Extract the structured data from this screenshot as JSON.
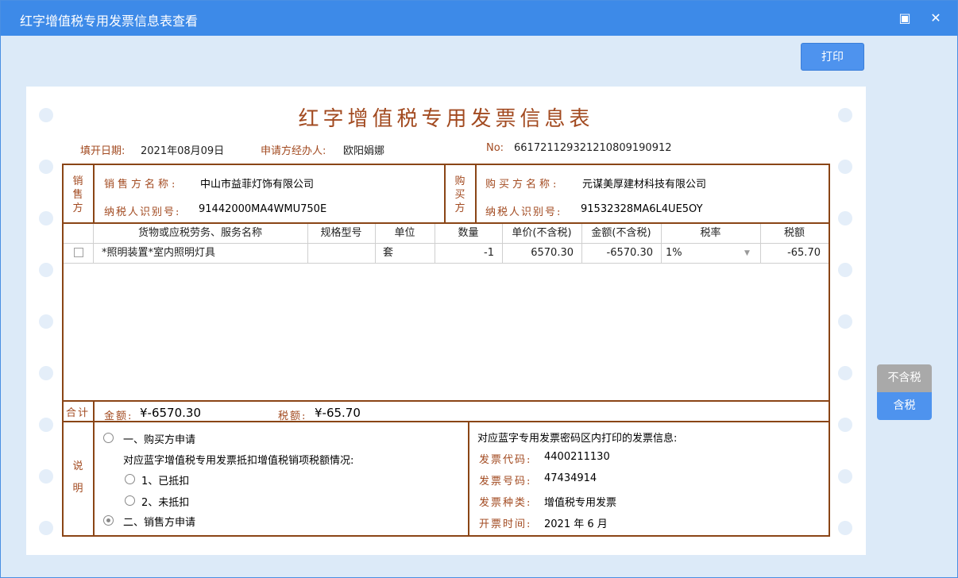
{
  "window": {
    "title": "红字增值税专用发票信息表查看",
    "maximize_glyph": "▣",
    "close_glyph": "✕"
  },
  "toolbar": {
    "print_label": "打印"
  },
  "doc": {
    "title": "红字增值税专用发票信息表",
    "fill_date_label": "填开日期:",
    "fill_date": "2021年08月09日",
    "applicant_label": "申请方经办人:",
    "applicant": "欧阳娟娜",
    "no_label": "No:",
    "no": "661721129321210809190912"
  },
  "seller": {
    "section": "销售方",
    "name_label": "销售方名称:",
    "name": "中山市益菲灯饰有限公司",
    "tax_label": "纳税人识别号:",
    "tax_id": "91442000MA4WMU750E"
  },
  "buyer": {
    "section": "购买方",
    "name_label": "购买方名称:",
    "name": "元谋美厚建材科技有限公司",
    "tax_label": "纳税人识别号:",
    "tax_id": "91532328MA6L4UE5OY"
  },
  "table": {
    "headers": [
      "货物或应税劳务、服务名称",
      "规格型号",
      "单位",
      "数量",
      "单价(不含税)",
      "金额(不含税)",
      "税率",
      "税额"
    ],
    "rows": [
      {
        "name": "*照明装置*室内照明灯具",
        "spec": "",
        "unit": "套",
        "qty": "-1",
        "price": "6570.30",
        "amount": "-6570.30",
        "rate": "1%",
        "tax": "-65.70"
      }
    ]
  },
  "total": {
    "label": "合计",
    "amount_label": "金额:",
    "amount": "¥-6570.30",
    "tax_label": "税额:",
    "tax": "¥-65.70"
  },
  "note": {
    "label": "说明",
    "opt1": "一、购买方申请",
    "sub_title": "对应蓝字增值税专用发票抵扣增值税销项税额情况:",
    "sub1": "1、已抵扣",
    "sub2": "2、未抵扣",
    "opt2": "二、销售方申请",
    "right_title": "对应蓝字专用发票密码区内打印的发票信息:",
    "code_label": "发票代码:",
    "code": "4400211130",
    "num_label": "发票号码:",
    "num": "47434914",
    "kind_label": "发票种类:",
    "kind": "增值税专用发票",
    "time_label": "开票时间:",
    "time": "2021 年 6 月"
  },
  "side": {
    "excl_tax": "不含税",
    "incl_tax": "含税"
  },
  "colors": {
    "accent": "#3d8ae8",
    "border": "#8a4516",
    "label": "#a24a20"
  }
}
